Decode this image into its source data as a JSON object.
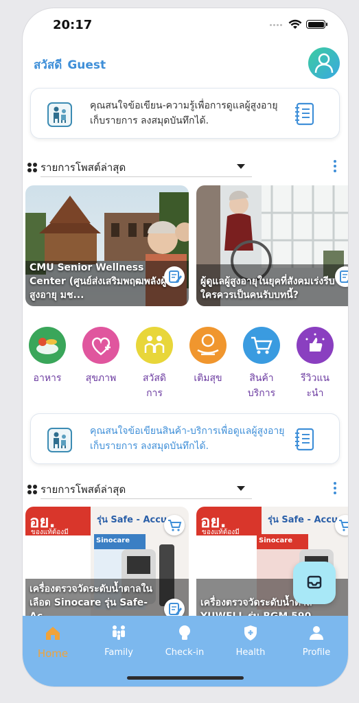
{
  "status_bar": {
    "time": "20:17"
  },
  "greeting": {
    "hello": "สวัสดี",
    "name": "Guest"
  },
  "banners": [
    {
      "text": "คุณสนใจข้อเขียน-ความรู้เพื่อการดูแลผู้สูงอายุ เก็บรายการ ลงสมุดบันทึกได้."
    },
    {
      "text": "คุณสนใจข้อเขียนสินค้า-บริการเพื่อดูแลผู้สูงอายุ เก็บรายการ ลงสมุดบันทึกได้."
    }
  ],
  "sections": [
    {
      "title": "รายการโพสต์ล่าสุด",
      "posts": [
        {
          "caption": "CMU Senior Wellness Center (ศูนย์ส่งเสริมพฤฒพลังผู้สูงอายุ มช..."
        },
        {
          "caption": "ผู้ดูแลผู้สูงอายุในยุคที่สังคมเร่งรีบ ใครควรเป็นคนรับบทนี้?"
        }
      ]
    },
    {
      "title": "รายการโพสต์ล่าสุด",
      "posts": [
        {
          "caption": "เครื่องตรวจวัดระดับน้ำตาลในเลือด Sinocare รุ่น Safe-Ac...",
          "img_top": "อย.",
          "img_sub": "ของแท้ต้องมี",
          "img_model": "รุ่น Safe - Accu",
          "img_brand": "Sinocare"
        },
        {
          "caption": "เครื่องตรวจวัดระดับน้ำตาล YUWELL รุ่น BGM 590",
          "img_top": "อย.",
          "img_sub": "ของแท้ต้องมี",
          "img_model": "รุ่น Safe - Accu",
          "img_brand": "Sinocare"
        }
      ]
    }
  ],
  "categories": [
    {
      "label": "อาหาร",
      "icon": "food-icon",
      "color": "#3aa65a"
    },
    {
      "label": "สุขภาพ",
      "icon": "health-heart-icon",
      "color": "#e0569e"
    },
    {
      "label": "สวัสดิการ",
      "icon": "welfare-people-icon",
      "color": "#e8d63a"
    },
    {
      "label": "เติมสุข",
      "icon": "happiness-icon",
      "color": "#f0962e"
    },
    {
      "label": "สินค้าบริการ",
      "icon": "cart-icon",
      "color": "#3a9be0"
    },
    {
      "label": "รีวิวแนะนำ",
      "icon": "review-thumbs-up-icon",
      "color": "#8a3fc0"
    }
  ],
  "tabbar": {
    "items": [
      {
        "label": "Home",
        "icon": "home-icon",
        "active": true
      },
      {
        "label": "Family",
        "icon": "family-icon"
      },
      {
        "label": "Check-in",
        "icon": "checkin-bulb-icon"
      },
      {
        "label": "Health",
        "icon": "health-shield-icon"
      },
      {
        "label": "Profile",
        "icon": "profile-icon"
      }
    ]
  },
  "colors": {
    "accent": "#3f8fd8",
    "tabbar": "#7cb8ee",
    "active_tab": "#f0a33a",
    "category_text": "#6b3aa0"
  }
}
